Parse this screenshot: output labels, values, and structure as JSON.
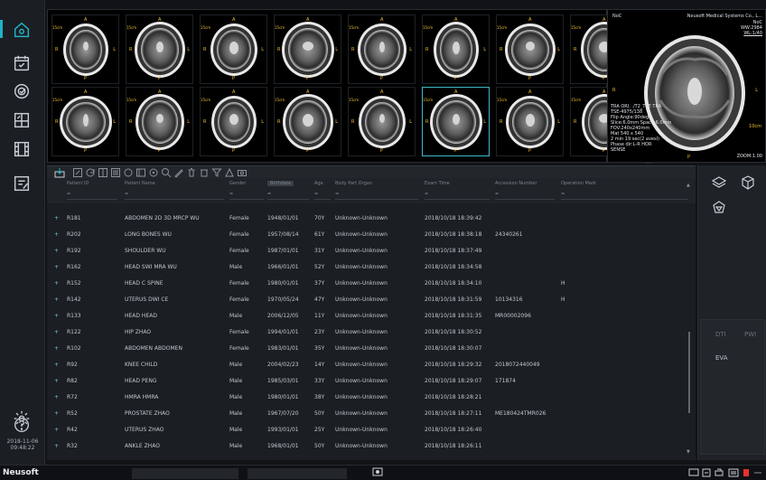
{
  "app": {
    "brand": "Neusoft",
    "clock_date": "2018-11-06",
    "clock_time": "09:48:22"
  },
  "rail": {
    "items": [
      {
        "name": "home"
      },
      {
        "name": "worklist"
      },
      {
        "name": "review"
      },
      {
        "name": "layout"
      },
      {
        "name": "film"
      },
      {
        "name": "report"
      }
    ]
  },
  "viewer": {
    "orientation": {
      "top": "A",
      "bottom": "P",
      "left": "R",
      "right": "L"
    },
    "scale": "15cm",
    "thumb_count": 16
  },
  "bigimage": {
    "corner_tl": "NoC",
    "vendor": "Neusoft Medical Systems Co., L...",
    "corner_tr1": "NoC",
    "corner_tr2": "WW:2984",
    "corner_tr3": "WL:1/40",
    "side_r": "R",
    "side_l": "L",
    "bottom_p": "P",
    "scale": "10cm",
    "params": [
      "TRA ORI. ./T2_TSE TRA",
      "TSE-4975/138",
      "Flip Angle:90deg",
      "Slice:6.0mm Space:6.0mm",
      "FOV:240x240mm",
      "Mat 540 x 540",
      "2 min 19 sec(2 avesl)",
      "Phase dir:L-R HOR",
      "SENSE"
    ],
    "zoom": "ZOOM:1.00"
  },
  "table": {
    "columns": [
      "Patient ID",
      "Patient Name",
      "Gender",
      "Birthdate",
      "Age",
      "Body Part Organ",
      "Exam Time",
      "Accession Number",
      "Operation Mark"
    ],
    "filter_ops": [
      "=",
      "=",
      "=",
      "=",
      "=",
      "=",
      "=",
      "=",
      "="
    ],
    "rows": [
      {
        "id": "R181",
        "name": "ABDOMEN 2D 3D MRCP WU",
        "gender": "Female",
        "birth": "1948/01/01",
        "age": "70Y",
        "body": "Unknown-Unknown",
        "time": "2018/10/18 18:39:42",
        "acc": "",
        "mark": ""
      },
      {
        "id": "R202",
        "name": "LONG BONES WU",
        "gender": "Female",
        "birth": "1957/08/14",
        "age": "61Y",
        "body": "Unknown-Unknown",
        "time": "2018/10/18 18:38:18",
        "acc": "24340261",
        "mark": ""
      },
      {
        "id": "R192",
        "name": "SHOULDER WU",
        "gender": "Female",
        "birth": "1987/01/01",
        "age": "31Y",
        "body": "Unknown-Unknown",
        "time": "2018/10/18 18:37:49",
        "acc": "",
        "mark": ""
      },
      {
        "id": "R162",
        "name": "HEAD SWI MRA WU",
        "gender": "Male",
        "birth": "1966/01/01",
        "age": "52Y",
        "body": "Unknown-Unknown",
        "time": "2018/10/18 18:34:58",
        "acc": "",
        "mark": ""
      },
      {
        "id": "R152",
        "name": "HEAD C SPINE",
        "gender": "Female",
        "birth": "1980/01/01",
        "age": "37Y",
        "body": "Unknown-Unknown",
        "time": "2018/10/18 18:34:10",
        "acc": "",
        "mark": "H"
      },
      {
        "id": "R142",
        "name": "UTERUS DWI CE",
        "gender": "Female",
        "birth": "1970/05/24",
        "age": "47Y",
        "body": "Unknown-Unknown",
        "time": "2018/10/18 18:31:59",
        "acc": "10134316",
        "mark": "H"
      },
      {
        "id": "R133",
        "name": "HEAD HEAD",
        "gender": "Male",
        "birth": "2006/12/05",
        "age": "11Y",
        "body": "Unknown-Unknown",
        "time": "2018/10/18 18:31:35",
        "acc": "MR00002096",
        "mark": ""
      },
      {
        "id": "R122",
        "name": "HIP ZHAO",
        "gender": "Female",
        "birth": "1994/01/01",
        "age": "23Y",
        "body": "Unknown-Unknown",
        "time": "2018/10/18 18:30:52",
        "acc": "",
        "mark": ""
      },
      {
        "id": "R102",
        "name": "ABDOMEN ABDOMEN",
        "gender": "Female",
        "birth": "1983/01/01",
        "age": "35Y",
        "body": "Unknown-Unknown",
        "time": "2018/10/18 18:30:07",
        "acc": "",
        "mark": ""
      },
      {
        "id": "R92",
        "name": "KNEE CHILD",
        "gender": "Male",
        "birth": "2004/02/23",
        "age": "14Y",
        "body": "Unknown-Unknown",
        "time": "2018/10/18 18:29:32",
        "acc": "2018072440049",
        "mark": ""
      },
      {
        "id": "R82",
        "name": "HEAD PENG",
        "gender": "Male",
        "birth": "1985/03/01",
        "age": "33Y",
        "body": "Unknown-Unknown",
        "time": "2018/10/18 18:29:07",
        "acc": "171874",
        "mark": ""
      },
      {
        "id": "R72",
        "name": "HMRA HMRA",
        "gender": "Male",
        "birth": "1980/01/01",
        "age": "38Y",
        "body": "Unknown-Unknown",
        "time": "2018/10/18 18:28:21",
        "acc": "",
        "mark": ""
      },
      {
        "id": "R52",
        "name": "PROSTATE ZHAO",
        "gender": "Male",
        "birth": "1967/07/20",
        "age": "50Y",
        "body": "Unknown-Unknown",
        "time": "2018/10/18 18:27:11",
        "acc": "ME180424TMR026",
        "mark": ""
      },
      {
        "id": "R42",
        "name": "UTERUS ZHAO",
        "gender": "Male",
        "birth": "1993/01/01",
        "age": "25Y",
        "body": "Unknown-Unknown",
        "time": "2018/10/18 18:26:40",
        "acc": "",
        "mark": ""
      },
      {
        "id": "R32",
        "name": "ANKLE ZHAO",
        "gender": "Male",
        "birth": "1968/01/01",
        "age": "50Y",
        "body": "Unknown-Unknown",
        "time": "2018/10/18 18:26:11",
        "acc": "",
        "mark": ""
      }
    ]
  },
  "rpanel": {
    "tabs": [
      "DTI",
      "PWI"
    ],
    "eva": "EVA"
  },
  "colors": {
    "accent": "#1fb3c6",
    "overlay": "#f1c232",
    "status_red": "#e8312f"
  }
}
